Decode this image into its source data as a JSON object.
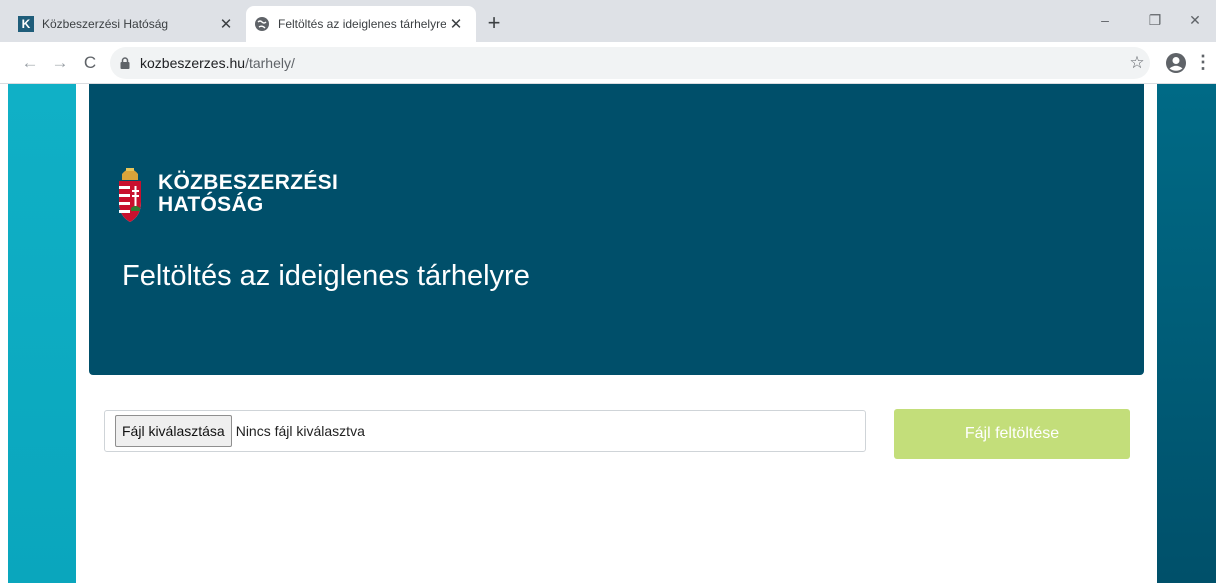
{
  "browser": {
    "tabs": [
      {
        "title": "Közbeszerzési Hatóság",
        "favicon": "k-logo-icon",
        "active": false
      },
      {
        "title": "Feltöltés az ideiglenes tárhelyre",
        "favicon": "globe-icon",
        "active": true
      }
    ],
    "tab_close_glyph": "✕",
    "new_tab_glyph": "+",
    "window_controls": {
      "minimize": "–",
      "restore": "❐",
      "close": "✕"
    },
    "nav": {
      "back": "←",
      "forward": "→",
      "reload": "C"
    },
    "url": {
      "host": "kozbeszerzes.hu",
      "path": "/tarhely/"
    },
    "bookmark_glyph": "☆",
    "menu_glyph": "⋮"
  },
  "header": {
    "logo_line1": "KÖZBESZERZÉSI",
    "logo_line2": "HATÓSÁG",
    "title": "Feltöltés az ideiglenes tárhelyre"
  },
  "upload": {
    "choose_label": "Fájl kiválasztása",
    "no_file_text": "Nincs fájl kiválasztva",
    "upload_label": "Fájl feltöltése"
  },
  "colors": {
    "hero_bg": "#004f6a",
    "side_left": "#10b0c6",
    "side_right": "#006a86",
    "upload_btn": "#c3de7a"
  }
}
